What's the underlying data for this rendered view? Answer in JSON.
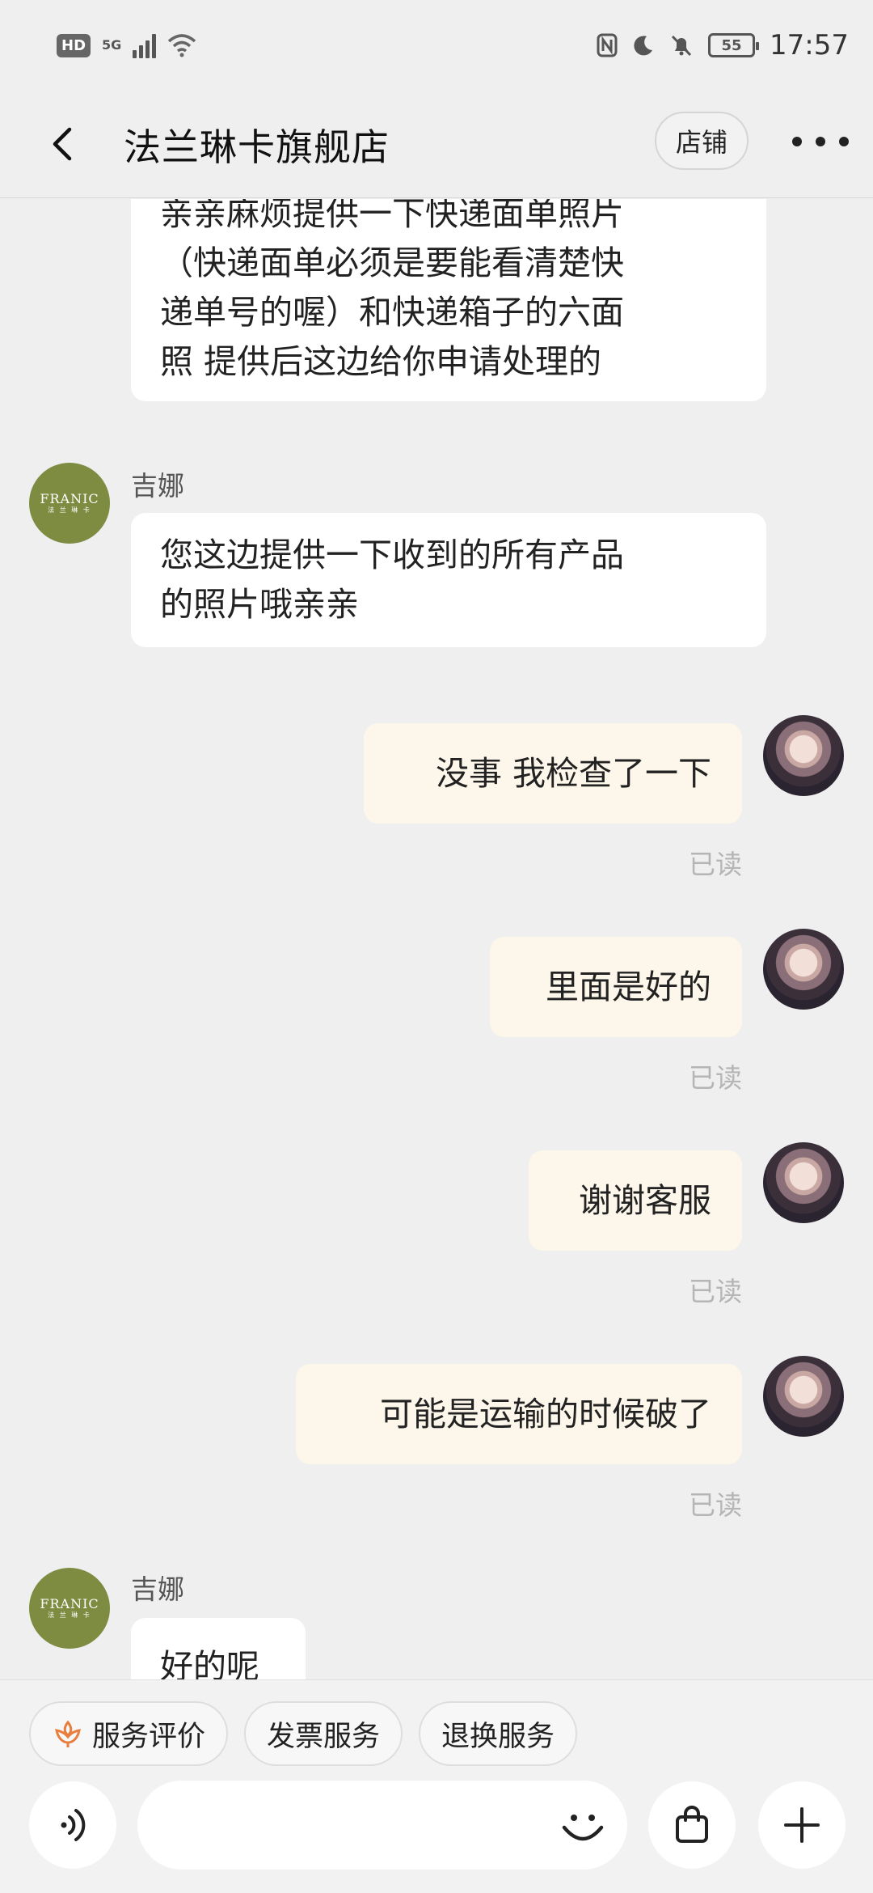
{
  "status_bar": {
    "hd": "HD",
    "network": "5G",
    "battery": "55",
    "time": "17:57"
  },
  "header": {
    "title": "法兰琳卡旗舰店",
    "store_label": "店铺"
  },
  "messages": [
    {
      "direction": "in",
      "lines": [
        "亲亲麻烦提供一下快递面单照片",
        "（快递面单必须是要能看清楚快",
        "递单号的喔）和快递箱子的六面",
        "照   提供后这边给你申请处理的"
      ]
    },
    {
      "direction": "in",
      "sender": "吉娜",
      "avatar_text": "FRANIC",
      "avatar_sub": "法 兰 琳 卡",
      "lines": [
        "您这边提供一下收到的所有产品",
        "的照片哦亲亲"
      ]
    },
    {
      "direction": "out",
      "text": "没事 我检查了一下",
      "status": "已读"
    },
    {
      "direction": "out",
      "text": "里面是好的",
      "status": "已读"
    },
    {
      "direction": "out",
      "text": "谢谢客服",
      "status": "已读"
    },
    {
      "direction": "out",
      "text": "可能是运输的时候破了",
      "status": "已读"
    },
    {
      "direction": "in",
      "sender": "吉娜",
      "avatar_text": "FRANIC",
      "avatar_sub": "法 兰 琳 卡",
      "text": "好的呢"
    }
  ],
  "quick_actions": [
    {
      "label": "服务评价",
      "icon": "flower-icon"
    },
    {
      "label": "发票服务"
    },
    {
      "label": "退换服务"
    }
  ],
  "input": {
    "placeholder": ""
  },
  "colors": {
    "background": "#efefef",
    "incoming_bubble": "#ffffff",
    "outgoing_bubble": "#fdf6ea",
    "avatar_brand": "#7e8c42",
    "accent": "#e87d3e",
    "read_status": "#b5b5b5"
  }
}
